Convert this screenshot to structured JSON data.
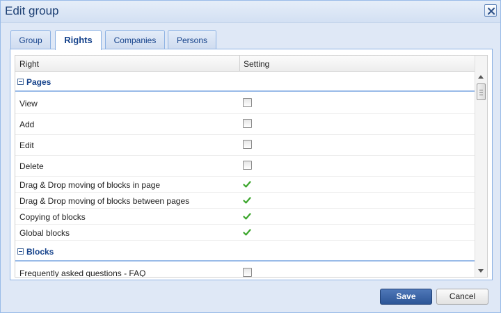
{
  "dialog": {
    "title": "Edit group"
  },
  "tabs": [
    {
      "label": "Group",
      "active": false
    },
    {
      "label": "Rights",
      "active": true
    },
    {
      "label": "Companies",
      "active": false
    },
    {
      "label": "Persons",
      "active": false
    }
  ],
  "grid": {
    "columns": [
      "Right",
      "Setting"
    ],
    "groups": [
      {
        "label": "Pages",
        "rows": [
          {
            "label": "View",
            "setting": "checkbox-unchecked"
          },
          {
            "label": "Add",
            "setting": "checkbox-unchecked"
          },
          {
            "label": "Edit",
            "setting": "checkbox-unchecked"
          },
          {
            "label": "Delete",
            "setting": "checkbox-unchecked"
          },
          {
            "label": "Drag & Drop moving of blocks in page",
            "setting": "check-icon"
          },
          {
            "label": "Drag & Drop moving of blocks between pages",
            "setting": "check-icon"
          },
          {
            "label": "Copying of blocks",
            "setting": "check-icon"
          },
          {
            "label": "Global blocks",
            "setting": "check-icon"
          }
        ]
      },
      {
        "label": "Blocks",
        "rows": [
          {
            "label": "Frequently asked questions - FAQ",
            "setting": "checkbox-unchecked"
          }
        ]
      }
    ]
  },
  "buttons": {
    "save": "Save",
    "cancel": "Cancel"
  },
  "colors": {
    "accent": "#15428b",
    "check": "#3aa52a",
    "save_button": "#2c5597"
  }
}
